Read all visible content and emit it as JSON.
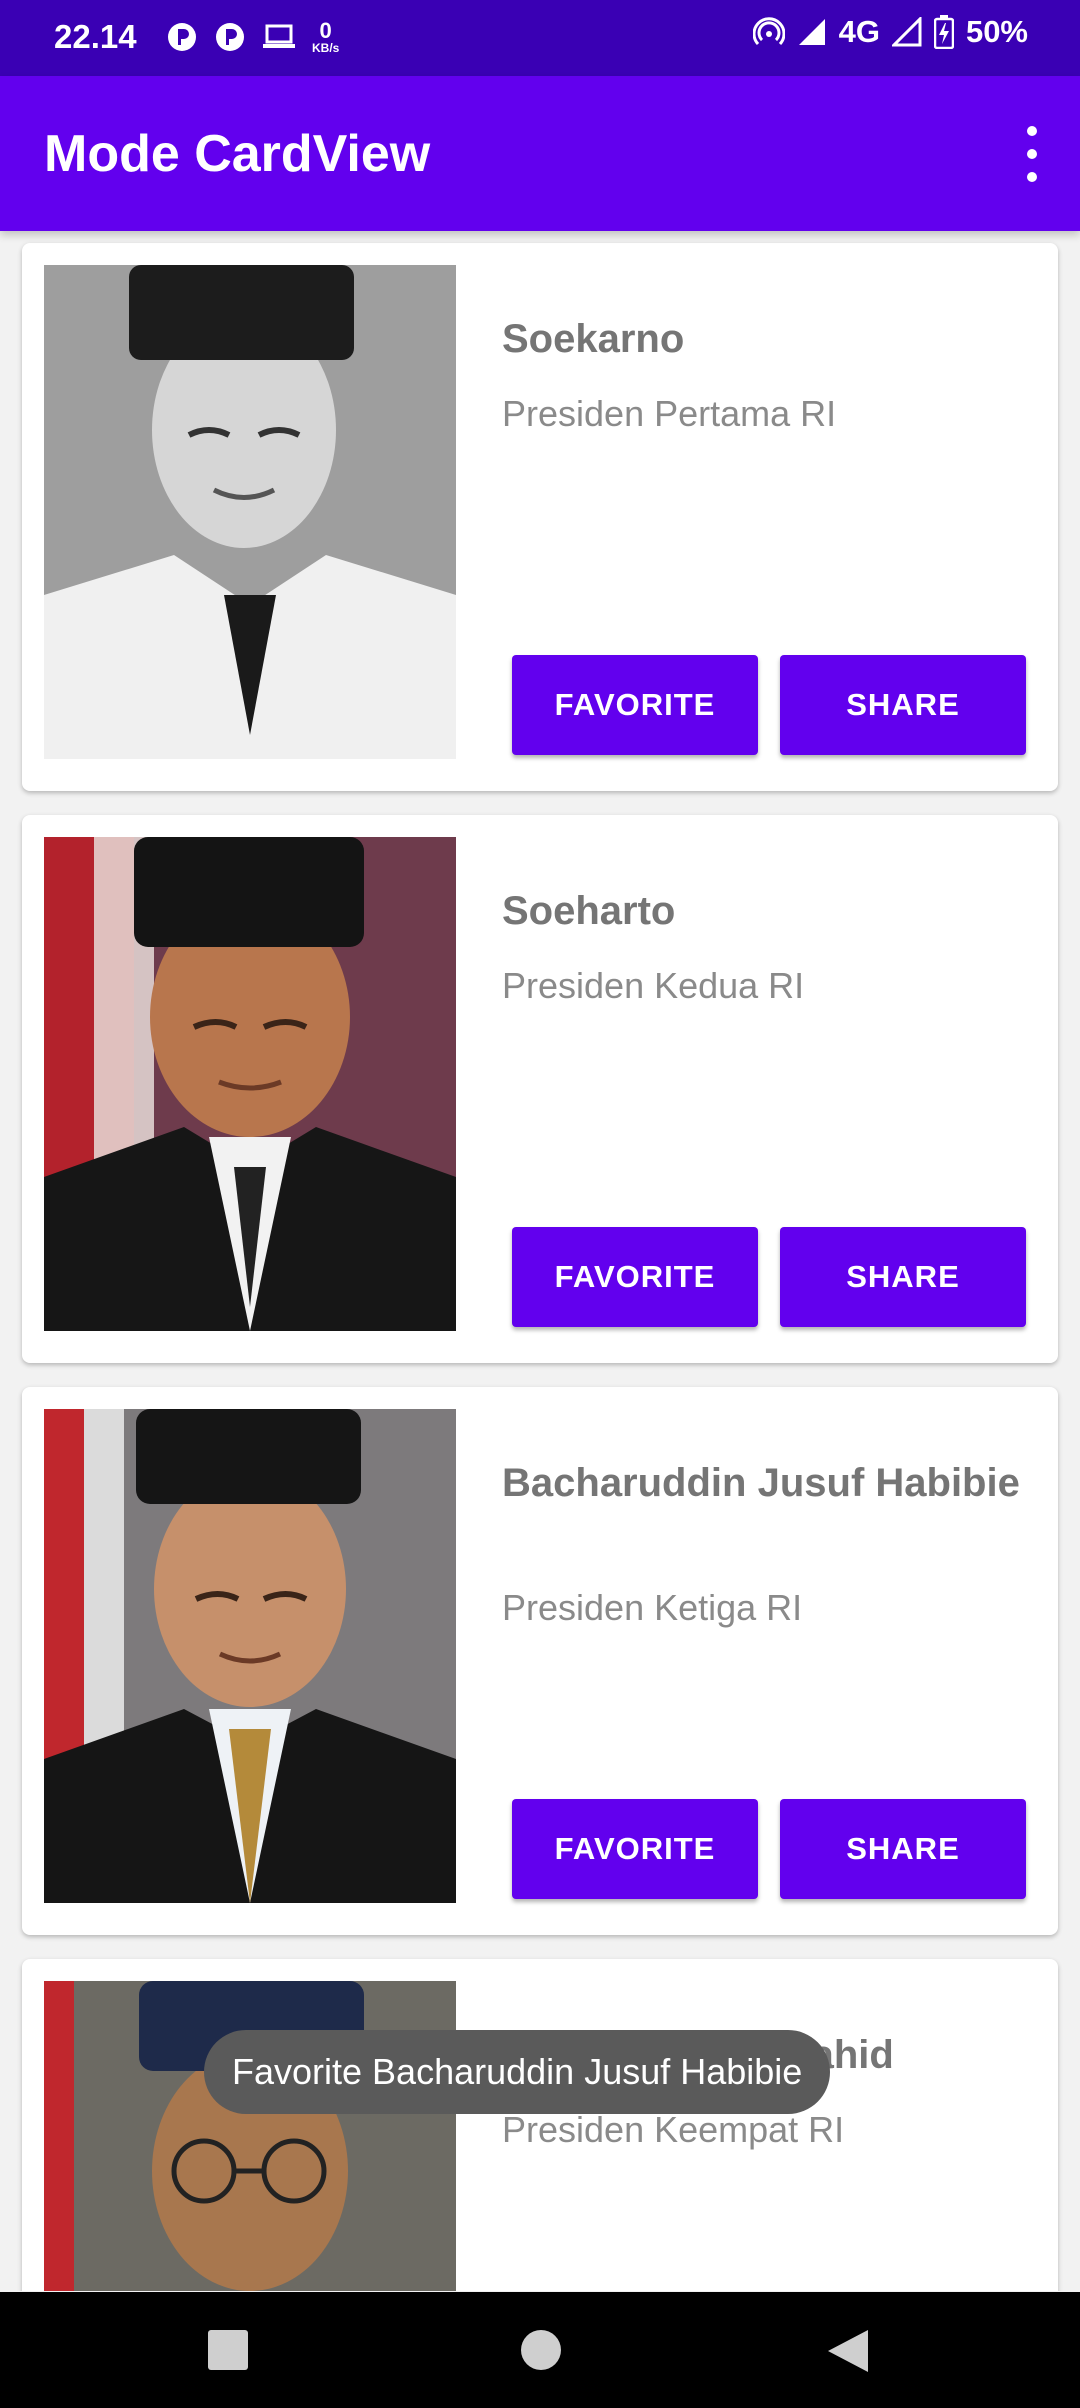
{
  "status_bar": {
    "time": "22.14",
    "speed_value": "0",
    "speed_unit": "KB/s",
    "network": "4G",
    "battery": "50%"
  },
  "app_bar": {
    "title": "Mode CardView",
    "menu_icon": "more-vert-icon"
  },
  "cards": [
    {
      "name": "Soekarno",
      "description": "Presiden Pertama RI",
      "favorite_label": "FAVORITE",
      "share_label": "SHARE"
    },
    {
      "name": "Soeharto",
      "description": "Presiden Kedua RI",
      "favorite_label": "FAVORITE",
      "share_label": "SHARE"
    },
    {
      "name": "Bacharuddin Jusuf Habibie",
      "description": "Presiden Ketiga RI",
      "favorite_label": "FAVORITE",
      "share_label": "SHARE"
    },
    {
      "name": "Abdurrahman Wahid",
      "description": "Presiden Keempat RI"
    }
  ],
  "toast": {
    "message": "Favorite Bacharuddin Jusuf Habibie"
  },
  "colors": {
    "primary": "#6200ee",
    "status_bar": "#3a00b4",
    "text_secondary": "#757575"
  }
}
